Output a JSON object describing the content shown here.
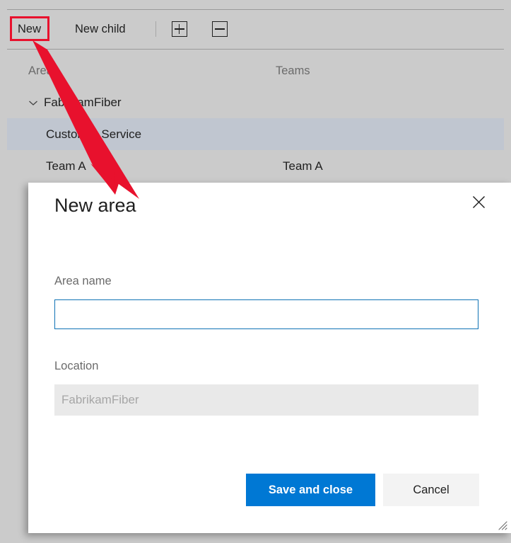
{
  "toolbar": {
    "new_label": "New",
    "new_child_label": "New child",
    "expand_all_icon": "expand-all-icon",
    "collapse_all_icon": "collapse-all-icon"
  },
  "grid": {
    "columns": [
      "Area",
      "Teams"
    ],
    "rows": [
      {
        "area": "FabrikamFiber",
        "teams": "",
        "level": 0,
        "expanded": true,
        "selected": false
      },
      {
        "area": "Customer Service",
        "teams": "",
        "level": 1,
        "expanded": false,
        "selected": true
      },
      {
        "area": "Team A",
        "teams": "Team A",
        "level": 1,
        "expanded": false,
        "selected": false
      }
    ]
  },
  "dialog": {
    "title": "New area",
    "close_icon": "close-icon",
    "area_name": {
      "label": "Area name",
      "value": "",
      "placeholder": ""
    },
    "location": {
      "label": "Location",
      "value": "FabrikamFiber"
    },
    "save_label": "Save and close",
    "cancel_label": "Cancel",
    "resize_grip_icon": "resize-grip-icon"
  },
  "colors": {
    "accent": "#0078d4",
    "annotation": "#e8112d",
    "input_border": "#0f72b5",
    "selected_row": "#c0c6d0",
    "app_background": "#cbcbcb"
  }
}
